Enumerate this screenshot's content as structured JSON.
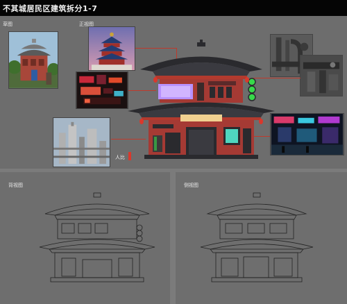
{
  "header": {
    "title": "不其城居民区建筑拆分1-7"
  },
  "labels": {
    "sketch": "草图",
    "front_view": "正视图",
    "scale": "人比",
    "back_view": "背视图",
    "side_view": "侧视图"
  },
  "colors": {
    "header_bg": "#050505",
    "page_bg": "#7b7b7b",
    "panel_bg": "#6e6e6e",
    "roof": "#2a2a2e",
    "wall_red": "#b23a2e",
    "neon_purple": "#b892ff",
    "neon_green": "#37d94a",
    "lantern": "#d9382c",
    "connector": "#c0392b"
  }
}
